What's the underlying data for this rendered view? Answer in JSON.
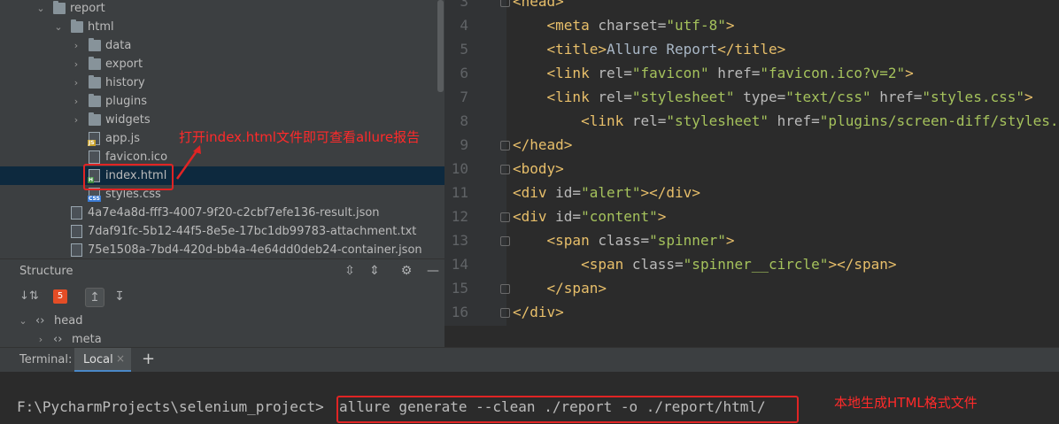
{
  "project_tree": {
    "items": [
      {
        "label": "report",
        "kind": "folder",
        "expanded": true
      },
      {
        "label": "html",
        "kind": "folder",
        "expanded": true
      },
      {
        "label": "data",
        "kind": "folder",
        "expanded": false
      },
      {
        "label": "export",
        "kind": "folder",
        "expanded": false
      },
      {
        "label": "history",
        "kind": "folder",
        "expanded": false
      },
      {
        "label": "plugins",
        "kind": "folder",
        "expanded": false
      },
      {
        "label": "widgets",
        "kind": "folder",
        "expanded": false
      },
      {
        "label": "app.js",
        "kind": "file",
        "tag": "JS"
      },
      {
        "label": "favicon.ico",
        "kind": "file",
        "tag": ""
      },
      {
        "label": "index.html",
        "kind": "file",
        "tag": "H",
        "selected": true
      },
      {
        "label": "styles.css",
        "kind": "file",
        "tag": "CSS"
      },
      {
        "label": "4a7e4a8d-fff3-4007-9f20-c2cbf7efe136-result.json",
        "kind": "file",
        "tag": ""
      },
      {
        "label": "7daf91fc-5b12-44f5-8e5e-17bc1db99783-attachment.txt",
        "kind": "file",
        "tag": ""
      },
      {
        "label": "75e1508a-7bd4-420d-bb4a-4e64dd0deb24-container.json",
        "kind": "file",
        "tag": ""
      }
    ]
  },
  "structure": {
    "title": "Structure",
    "items": [
      {
        "label": "head"
      },
      {
        "label": "meta"
      }
    ]
  },
  "editor": {
    "lines": [
      {
        "n": "3",
        "code": "<head>"
      },
      {
        "n": "4",
        "code": "    <meta charset=\"utf-8\">"
      },
      {
        "n": "5",
        "code": "    <title>Allure Report</title>"
      },
      {
        "n": "6",
        "code": "    <link rel=\"favicon\" href=\"favicon.ico?v=2\">"
      },
      {
        "n": "7",
        "code": "    <link rel=\"stylesheet\" type=\"text/css\" href=\"styles.css\">"
      },
      {
        "n": "8",
        "code": "        <link rel=\"stylesheet\" href=\"plugins/screen-diff/styles.css\">"
      },
      {
        "n": "9",
        "code": "</head>"
      },
      {
        "n": "10",
        "code": "<body>"
      },
      {
        "n": "11",
        "code": "<div id=\"alert\"></div>"
      },
      {
        "n": "12",
        "code": "<div id=\"content\">"
      },
      {
        "n": "13",
        "code": "    <span class=\"spinner\">"
      },
      {
        "n": "14",
        "code": "        <span class=\"spinner__circle\"></span>"
      },
      {
        "n": "15",
        "code": "    </span>"
      },
      {
        "n": "16",
        "code": "</div>"
      }
    ]
  },
  "terminal": {
    "label": "Terminal:",
    "tab": "Local",
    "prompt": "F:\\PycharmProjects\\selenium_project>",
    "command": "allure generate --clean ./report -o ./report/html/"
  },
  "annotations": {
    "open_index_note": "打开index.html文件即可查看allure报告",
    "generate_note": "本地生成HTML格式文件"
  },
  "colors": {
    "annotation_red": "#e02424",
    "selected_row": "#0d293e"
  }
}
